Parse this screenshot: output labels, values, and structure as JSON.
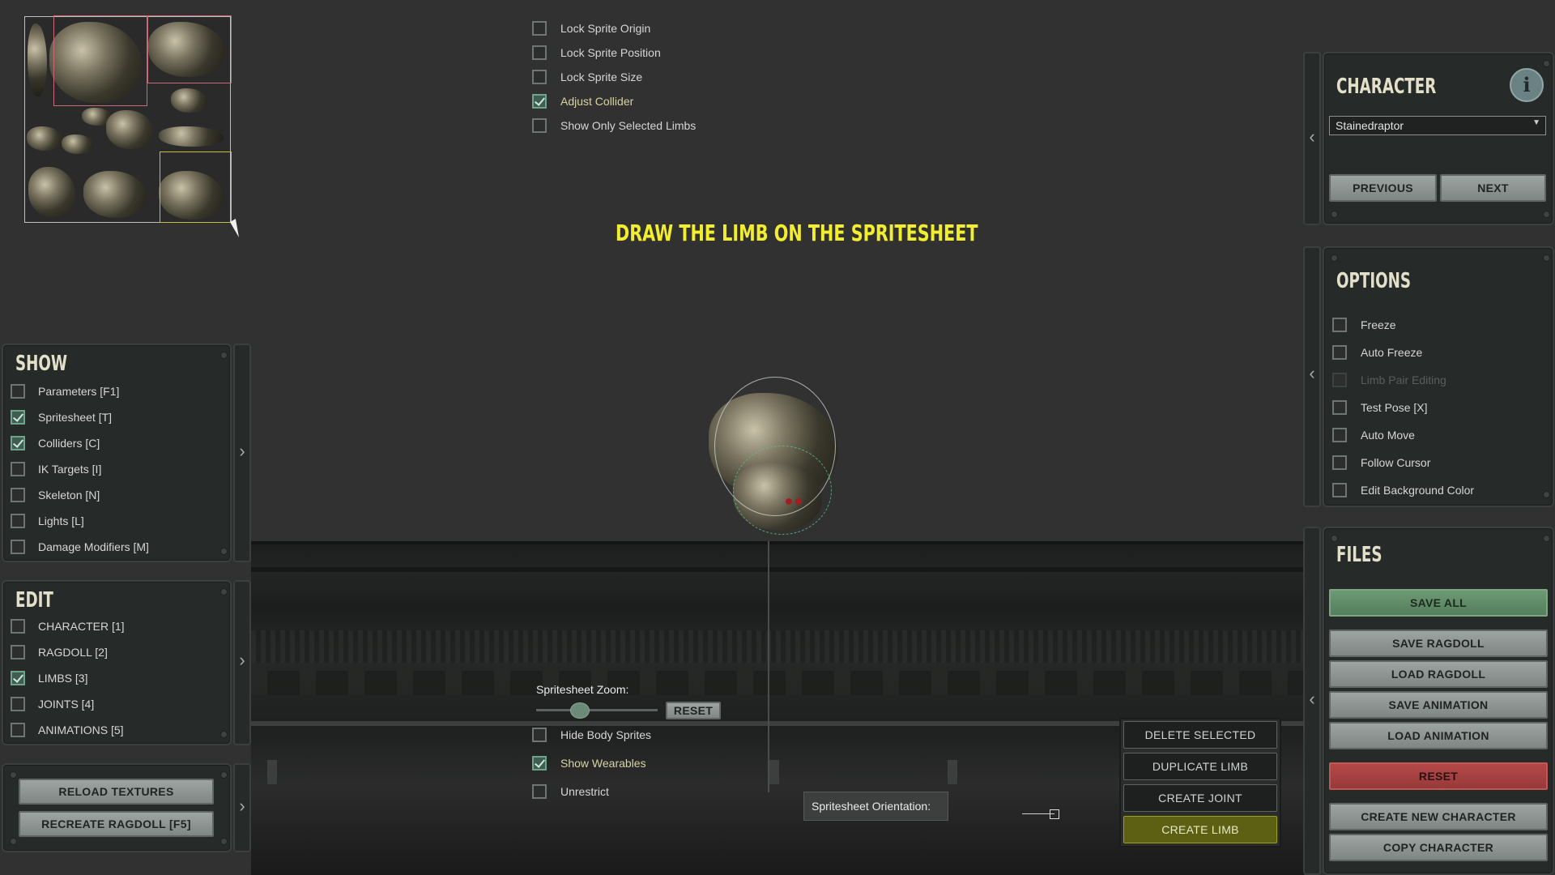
{
  "top_options": [
    {
      "label": "Lock Sprite Origin",
      "checked": false
    },
    {
      "label": "Lock Sprite Position",
      "checked": false
    },
    {
      "label": "Lock Sprite Size",
      "checked": false
    },
    {
      "label": "Adjust Collider",
      "checked": true
    },
    {
      "label": "Show Only Selected Limbs",
      "checked": false
    }
  ],
  "instruction": "DRAW THE LIMB ON THE SPRITESHEET",
  "show_panel": {
    "title": "SHOW",
    "items": [
      {
        "label": "Parameters [F1]",
        "checked": false
      },
      {
        "label": "Spritesheet [T]",
        "checked": true
      },
      {
        "label": "Colliders [C]",
        "checked": true
      },
      {
        "label": "IK Targets [I]",
        "checked": false
      },
      {
        "label": "Skeleton [N]",
        "checked": false
      },
      {
        "label": "Lights [L]",
        "checked": false
      },
      {
        "label": "Damage Modifiers [M]",
        "checked": false
      }
    ]
  },
  "edit_panel": {
    "title": "EDIT",
    "items": [
      {
        "label": "CHARACTER [1]",
        "checked": false
      },
      {
        "label": "RAGDOLL [2]",
        "checked": false
      },
      {
        "label": "LIMBS [3]",
        "checked": true
      },
      {
        "label": "JOINTS [4]",
        "checked": false
      },
      {
        "label": "ANIMATIONS [5]",
        "checked": false
      }
    ]
  },
  "tools_panel": {
    "reload_textures": "RELOAD TEXTURES",
    "recreate_ragdoll": "RECREATE RAGDOLL [F5]"
  },
  "character_panel": {
    "title": "CHARACTER",
    "selected_character": "Stainedraptor",
    "previous": "PREVIOUS",
    "next": "NEXT",
    "info_icon": "i"
  },
  "options_panel": {
    "title": "OPTIONS",
    "items": [
      {
        "label": "Freeze",
        "checked": false,
        "disabled": false
      },
      {
        "label": "Auto Freeze",
        "checked": false,
        "disabled": false
      },
      {
        "label": "Limb Pair Editing",
        "checked": false,
        "disabled": true
      },
      {
        "label": "Test Pose [X]",
        "checked": false,
        "disabled": false
      },
      {
        "label": "Auto Move",
        "checked": false,
        "disabled": false
      },
      {
        "label": "Follow Cursor",
        "checked": false,
        "disabled": false
      },
      {
        "label": "Edit Background Color",
        "checked": false,
        "disabled": false
      }
    ]
  },
  "files_panel": {
    "title": "FILES",
    "save_all": "SAVE ALL",
    "save_ragdoll": "SAVE RAGDOLL",
    "load_ragdoll": "LOAD RAGDOLL",
    "save_animation": "SAVE ANIMATION",
    "load_animation": "LOAD ANIMATION",
    "reset": "RESET",
    "create_new_character": "CREATE NEW CHARACTER",
    "copy_character": "COPY CHARACTER"
  },
  "spritesheet_controls": {
    "zoom_label": "Spritesheet Zoom:",
    "zoom_reset": "RESET",
    "zoom_level": 0.35,
    "hide_body_sprites": {
      "label": "Hide Body Sprites",
      "checked": false
    },
    "show_wearables": {
      "label": "Show Wearables",
      "checked": true
    },
    "unrestrict": {
      "label": "Unrestrict",
      "checked": false
    },
    "orientation_label": "Spritesheet Orientation:"
  },
  "limb_actions": {
    "delete_selected": "DELETE SELECTED",
    "duplicate_limb": "DUPLICATE LIMB",
    "create_joint": "CREATE JOINT",
    "create_limb": "CREATE LIMB"
  },
  "colors": {
    "instruction": "#f2ee2e",
    "accent_green": "#6d9a74",
    "danger_red": "#b44848",
    "create_limb": "#5d5f13"
  }
}
